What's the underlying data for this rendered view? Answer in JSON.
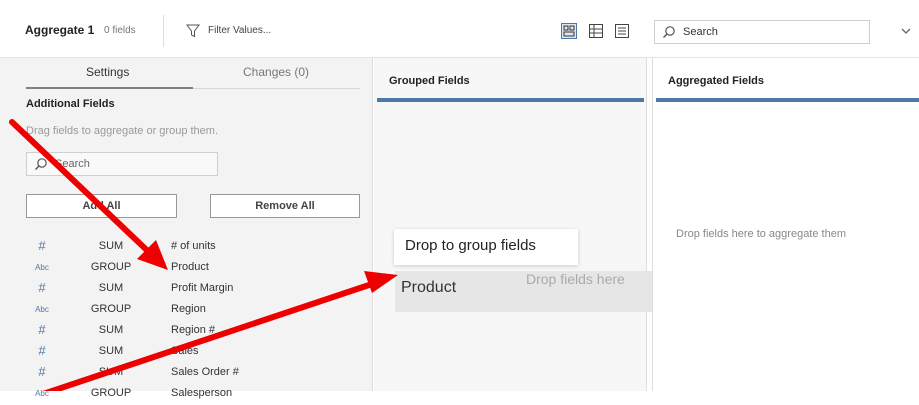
{
  "header": {
    "title": "Aggregate 1",
    "field_count": "0 fields",
    "filter_label": "Filter Values...",
    "search_placeholder": "Search"
  },
  "settings": {
    "tabs": [
      {
        "label": "Settings",
        "active": true
      },
      {
        "label": "Changes (0)",
        "active": false
      }
    ],
    "section_title": "Additional Fields",
    "hint": "Drag fields to aggregate or group them.",
    "search_placeholder": "Search",
    "add_all_label": "Add All",
    "remove_all_label": "Remove All",
    "fields": [
      {
        "type_icon": "hash-icon",
        "type_glyph": "#",
        "aggregation": "SUM",
        "name": "# of units"
      },
      {
        "type_icon": "abc-icon",
        "type_glyph": "Abc",
        "aggregation": "GROUP",
        "name": "Product"
      },
      {
        "type_icon": "hash-icon",
        "type_glyph": "#",
        "aggregation": "SUM",
        "name": "Profit Margin"
      },
      {
        "type_icon": "abc-icon",
        "type_glyph": "Abc",
        "aggregation": "GROUP",
        "name": "Region"
      },
      {
        "type_icon": "hash-icon",
        "type_glyph": "#",
        "aggregation": "SUM",
        "name": "Region #"
      },
      {
        "type_icon": "hash-icon",
        "type_glyph": "#",
        "aggregation": "SUM",
        "name": "Sales"
      },
      {
        "type_icon": "hash-icon",
        "type_glyph": "#",
        "aggregation": "SUM",
        "name": "Sales Order #"
      },
      {
        "type_icon": "abc-icon",
        "type_glyph": "Abc",
        "aggregation": "GROUP",
        "name": "Salesperson"
      }
    ]
  },
  "grouped": {
    "title": "Grouped Fields",
    "drop_hint": "Drop fields here",
    "dragged_field": "Product",
    "tooltip": "Drop to group fields"
  },
  "aggregated": {
    "title": "Aggregated Fields",
    "drop_hint": "Drop fields here to aggregate them"
  },
  "colors": {
    "accent": "#4e79a7",
    "annotation": "#ee0000"
  }
}
